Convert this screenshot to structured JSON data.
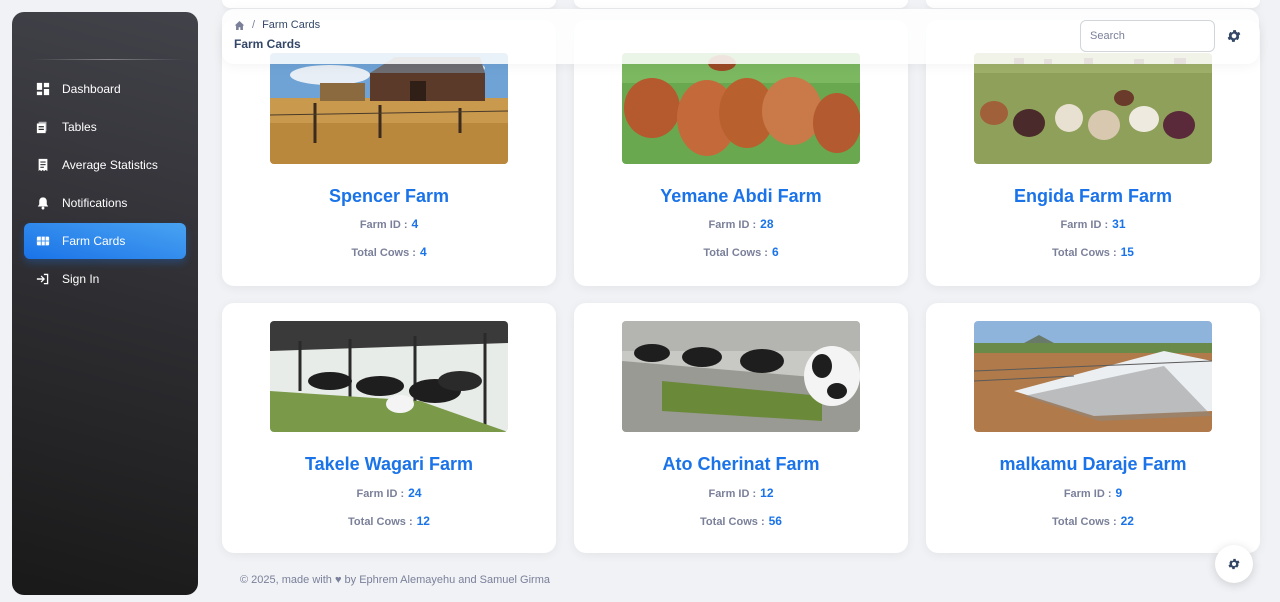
{
  "sidebar": {
    "items": [
      {
        "label": "Dashboard",
        "icon": "dashboard-icon"
      },
      {
        "label": "Tables",
        "icon": "table-icon"
      },
      {
        "label": "Average Statistics",
        "icon": "receipt-icon"
      },
      {
        "label": "Notifications",
        "icon": "bell-icon"
      },
      {
        "label": "Farm Cards",
        "icon": "grid-icon",
        "active": true
      },
      {
        "label": "Sign In",
        "icon": "login-icon"
      }
    ]
  },
  "topbar": {
    "breadcrumb_current": "Farm Cards",
    "page_title": "Farm Cards",
    "search_placeholder": "Search"
  },
  "labels": {
    "farm_id": "Farm ID :",
    "total_cows": "Total Cows :"
  },
  "farms": [
    {
      "name": "Spencer Farm",
      "farm_id": "4",
      "total_cows": "4",
      "image": "barn-image"
    },
    {
      "name": "Yemane Abdi Farm",
      "farm_id": "28",
      "total_cows": "6",
      "image": "brown-cows-image"
    },
    {
      "name": "Engida Farm Farm",
      "farm_id": "31",
      "total_cows": "15",
      "image": "herd-field-image"
    },
    {
      "name": "Takele Wagari Farm",
      "farm_id": "24",
      "total_cows": "12",
      "image": "cow-shed-image"
    },
    {
      "name": "Ato Cherinat Farm",
      "farm_id": "12",
      "total_cows": "56",
      "image": "feeding-cows-image"
    },
    {
      "name": "malkamu Daraje Farm",
      "farm_id": "9",
      "total_cows": "22",
      "image": "farm-building-image"
    }
  ],
  "footer": {
    "prefix": "© 2025, made with",
    "suffix": "by Ephrem Alemayehu and Samuel Girma"
  },
  "colors": {
    "accent": "#1A73E8",
    "sidebar": "#191919",
    "text": "#344767",
    "muted": "#7b809a"
  }
}
